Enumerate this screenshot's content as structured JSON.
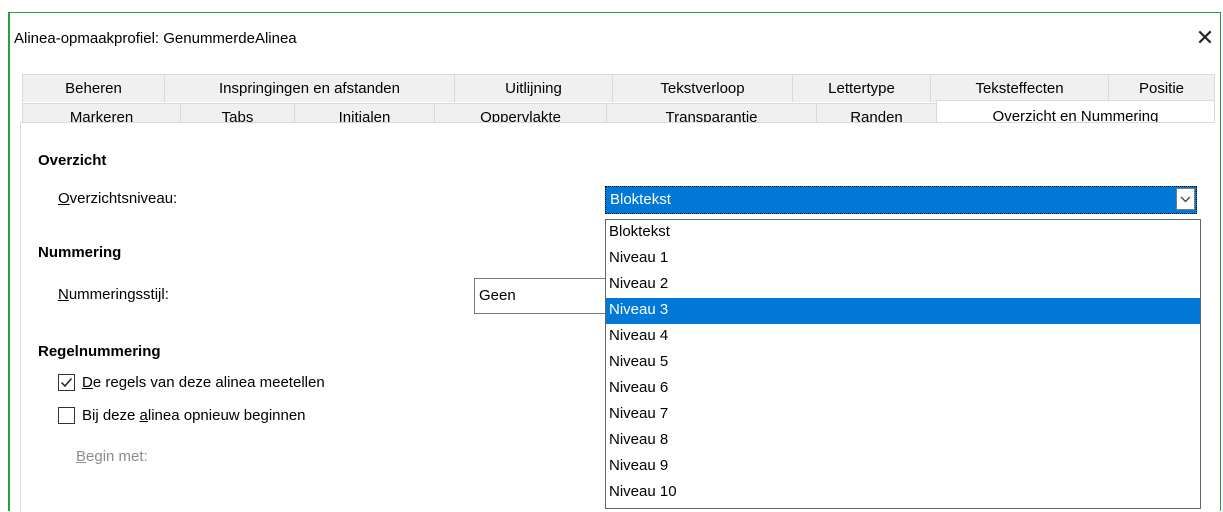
{
  "window": {
    "title": "Alinea-opmaakprofiel: GenummerdeAlinea"
  },
  "icons": {
    "close": "close-icon",
    "dropdown_arrow": "chevron-down-icon",
    "checkmark": "checkmark-icon"
  },
  "colors": {
    "accent": "#0078d7",
    "window_border": "#2e9c3e"
  },
  "tabs_row1": [
    "Beheren",
    "Inspringingen en afstanden",
    "Uitlijning",
    "Tekstverloop",
    "Lettertype",
    "Teksteffecten",
    "Positie"
  ],
  "tabs_row2": [
    "Markeren",
    "Tabs",
    "Initialen",
    "Oppervlakte",
    "Transparantie",
    "Randen",
    "Overzicht en Nummering"
  ],
  "active_tab": "Overzicht en Nummering",
  "overzicht": {
    "heading": "Overzicht",
    "level_label_mnemonic": "O",
    "level_label_rest": "verzichtsniveau:",
    "level_value": "Bloktekst"
  },
  "nummering": {
    "heading": "Nummering",
    "style_label_mnemonic": "N",
    "style_label_rest": "ummeringsstijl:",
    "style_value": "Geen"
  },
  "regelnummering": {
    "heading": "Regelnummering",
    "count_lines": {
      "mnemonic": "D",
      "rest": "e regels van deze alinea meetellen",
      "checked": true
    },
    "restart": {
      "before": "Bij deze ",
      "mnemonic": "a",
      "after": "linea opnieuw beginnen",
      "checked": false
    },
    "begin_mnemonic": "B",
    "begin_rest": "egin met:"
  },
  "dropdown": {
    "options": [
      "Bloktekst",
      "Niveau 1",
      "Niveau 2",
      "Niveau 3",
      "Niveau 4",
      "Niveau 5",
      "Niveau 6",
      "Niveau 7",
      "Niveau 8",
      "Niveau 9",
      "Niveau 10"
    ],
    "highlighted": "Niveau 3"
  }
}
